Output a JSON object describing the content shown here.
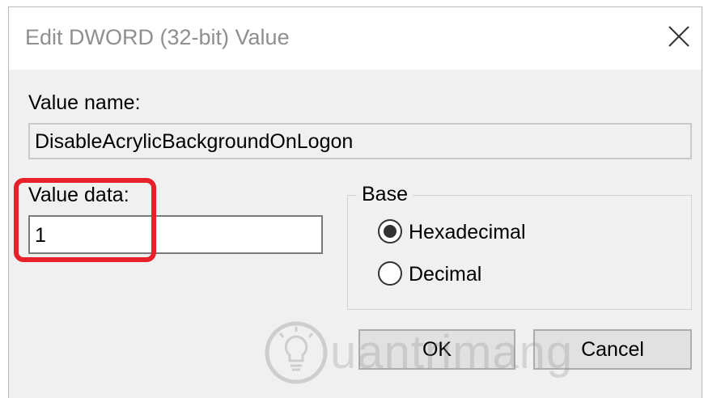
{
  "dialog": {
    "title": "Edit DWORD (32-bit) Value",
    "close_icon": "close-icon"
  },
  "value_name": {
    "label": "Value name:",
    "value": "DisableAcrylicBackgroundOnLogon"
  },
  "value_data": {
    "label": "Value data:",
    "value": "1",
    "highlight_color": "#e8202a"
  },
  "base": {
    "label": "Base",
    "options": [
      {
        "label": "Hexadecimal",
        "selected": true
      },
      {
        "label": "Decimal",
        "selected": false
      }
    ]
  },
  "buttons": {
    "ok": "OK",
    "cancel": "Cancel"
  },
  "watermark": {
    "text": "uantrimang",
    "icon": "lightbulb-icon"
  }
}
